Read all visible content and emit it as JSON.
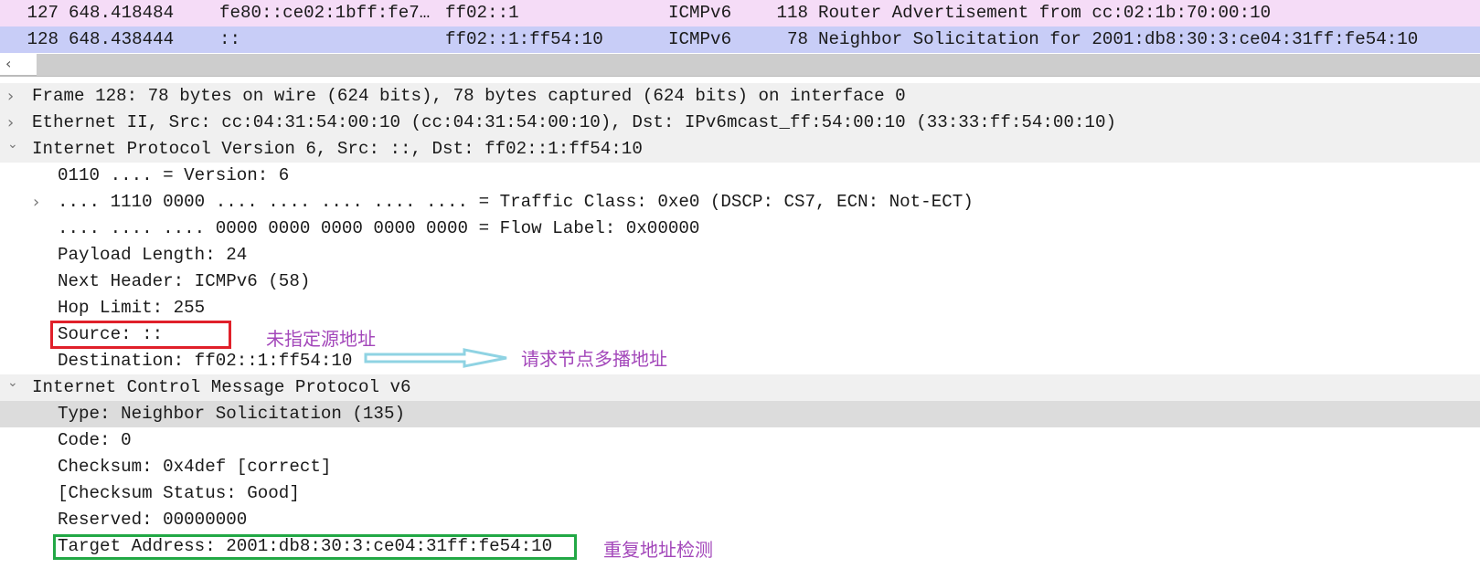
{
  "packet_list": {
    "rows": [
      {
        "no": "127",
        "time": "648.418484",
        "source": "fe80::ce02:1bff:fe7…",
        "destination": "ff02::1",
        "protocol": "ICMPv6",
        "length": "118",
        "info": "Router Advertisement from cc:02:1b:70:00:10",
        "color": "#f5dcf7"
      },
      {
        "no": "128",
        "time": "648.438444",
        "source": "::",
        "destination": "ff02::1:ff54:10",
        "protocol": "ICMPv6",
        "length": "78",
        "info": "Neighbor Solicitation for 2001:db8:30:3:ce04:31ff:fe54:10",
        "color": "#c8cdf7"
      }
    ]
  },
  "scrollbar": {
    "left_arrow": "‹"
  },
  "details": {
    "rows": [
      {
        "level": 0,
        "expander": "collapsed",
        "text": "Frame 128: 78 bytes on wire (624 bits), 78 bytes captured (624 bits) on interface 0"
      },
      {
        "level": 0,
        "expander": "collapsed",
        "text": "Ethernet II, Src: cc:04:31:54:00:10 (cc:04:31:54:00:10), Dst: IPv6mcast_ff:54:00:10 (33:33:ff:54:00:10)"
      },
      {
        "level": 0,
        "expander": "expanded",
        "text": "Internet Protocol Version 6, Src: ::, Dst: ff02::1:ff54:10"
      },
      {
        "level": 1,
        "expander": "none",
        "text": "0110 .... = Version: 6"
      },
      {
        "level": 1,
        "expander": "collapsed",
        "text": ".... 1110 0000 .... .... .... .... .... = Traffic Class: 0xe0 (DSCP: CS7, ECN: Not-ECT)"
      },
      {
        "level": 1,
        "expander": "none",
        "text": ".... .... .... 0000 0000 0000 0000 0000 = Flow Label: 0x00000"
      },
      {
        "level": 1,
        "expander": "none",
        "text": "Payload Length: 24"
      },
      {
        "level": 1,
        "expander": "none",
        "text": "Next Header: ICMPv6 (58)"
      },
      {
        "level": 1,
        "expander": "none",
        "text": "Hop Limit: 255"
      },
      {
        "level": 1,
        "expander": "none",
        "text": "Source: ::"
      },
      {
        "level": 1,
        "expander": "none",
        "text": "Destination: ff02::1:ff54:10"
      },
      {
        "level": 0,
        "expander": "expanded",
        "text": "Internet Control Message Protocol v6"
      },
      {
        "level": 1,
        "expander": "none",
        "text": "Type: Neighbor Solicitation (135)",
        "selected": true
      },
      {
        "level": 1,
        "expander": "none",
        "text": "Code: 0"
      },
      {
        "level": 1,
        "expander": "none",
        "text": "Checksum: 0x4def [correct]"
      },
      {
        "level": 1,
        "expander": "none",
        "text": "[Checksum Status: Good]"
      },
      {
        "level": 1,
        "expander": "none",
        "text": "Reserved: 00000000"
      },
      {
        "level": 1,
        "expander": "none",
        "text": "Target Address: 2001:db8:30:3:ce04:31ff:fe54:10"
      }
    ]
  },
  "annotations": {
    "source_note": "未指定源地址",
    "destination_note": "请求节点多播地址",
    "target_note": "重复地址检测",
    "colors": {
      "red_box": "#e0202a",
      "green_box": "#22a845",
      "arrow": "#8fd3e3",
      "text": "#a347ba"
    }
  }
}
